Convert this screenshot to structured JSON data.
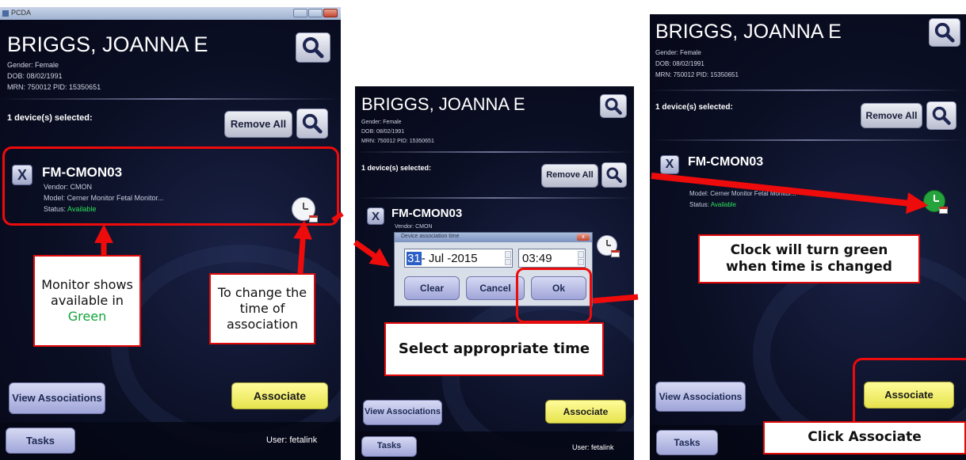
{
  "app": {
    "title": "PCDA"
  },
  "patient": {
    "name": "BRIGGS, JOANNA E",
    "gender_line": "Gender: Female",
    "dob_line": "DOB: 08/02/1991",
    "ids_line": "MRN: 750012   PID: 15350651"
  },
  "selection": {
    "label": "1 device(s) selected:",
    "remove_all": "Remove All"
  },
  "device": {
    "name": "FM-CMON03",
    "remove_glyph": "X",
    "vendor_line": "Vendor: CMON",
    "model_line": "Model: Cerner Monitor Fetal Monitor...",
    "status_prefix": "Status:",
    "status_value": "Available"
  },
  "buttons": {
    "view_associations": "View Associations",
    "associate": "Associate",
    "tasks": "Tasks"
  },
  "user_label": "User: fetalink",
  "dialog": {
    "title": "Device association time",
    "close_glyph": "x",
    "date_day": "31",
    "date_rest": "- Jul -2015",
    "time": "03:49",
    "clear": "Clear",
    "cancel": "Cancel",
    "ok": "Ok"
  },
  "callouts": {
    "monitor_available_1": "Monitor shows available in",
    "monitor_available_2": "Green",
    "change_time": "To change the time of association",
    "select_time": "Select appropriate time",
    "clock_green": "Clock will turn green when time is changed",
    "click_associate": "Click Associate"
  },
  "colors": {
    "status_available": "#2ee05a",
    "annotation_red": "#ee0b0b",
    "associate_button": "#f2ef6a",
    "clock_changed": "#25a33c"
  },
  "icons": [
    "search-icon",
    "clock-calendar-icon",
    "remove-device-icon",
    "window-close-icon"
  ]
}
